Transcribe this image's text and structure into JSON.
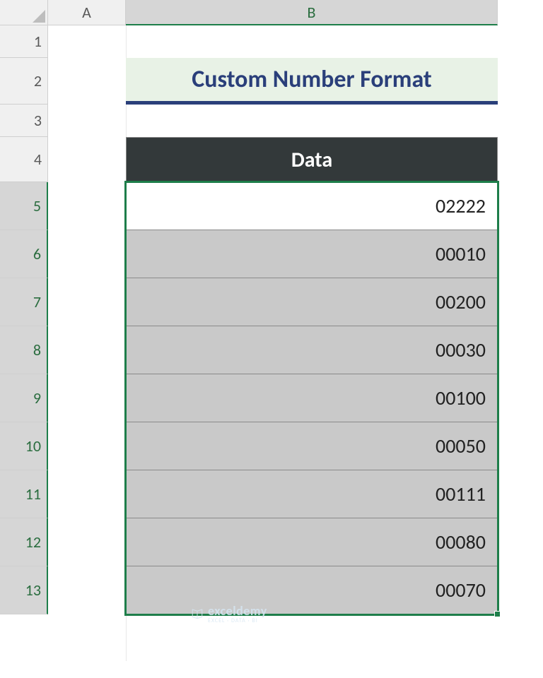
{
  "columns": {
    "a": "A",
    "b": "B"
  },
  "rows": {
    "r1": "1",
    "r2": "2",
    "r3": "3",
    "r4": "4",
    "r5": "5",
    "r6": "6",
    "r7": "7",
    "r8": "8",
    "r9": "9",
    "r10": "10",
    "r11": "11",
    "r12": "12",
    "r13": "13"
  },
  "title": "Custom Number Format",
  "table_header": "Data",
  "data": {
    "0": "02222",
    "1": "00010",
    "2": "00200",
    "3": "00030",
    "4": "00100",
    "5": "00050",
    "6": "00111",
    "7": "00080",
    "8": "00070"
  },
  "watermark": {
    "brand": "exceldemy",
    "sub": "EXCEL · DATA · BI"
  }
}
